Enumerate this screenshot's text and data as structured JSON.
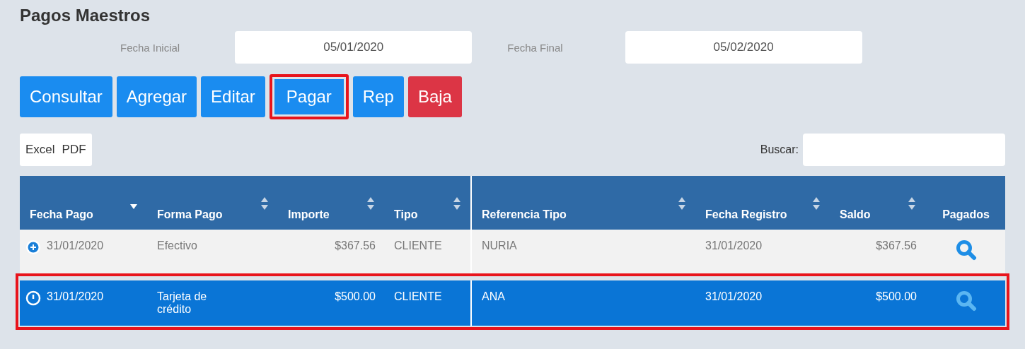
{
  "title": "Pagos Maestros",
  "date_filters": [
    {
      "label": "Fecha Inicial",
      "value": "05/01/2020"
    },
    {
      "label": "Fecha Final",
      "value": "05/02/2020"
    }
  ],
  "buttons": [
    {
      "label": "Consultar",
      "kind": "primary",
      "highlighted": false
    },
    {
      "label": "Agregar",
      "kind": "primary",
      "highlighted": false
    },
    {
      "label": "Editar",
      "kind": "primary",
      "highlighted": false
    },
    {
      "label": "Pagar",
      "kind": "primary",
      "highlighted": true
    },
    {
      "label": "Rep",
      "kind": "primary",
      "highlighted": false
    },
    {
      "label": "Baja",
      "kind": "danger",
      "highlighted": false
    }
  ],
  "export_buttons": [
    "Excel",
    "PDF"
  ],
  "search": {
    "label": "Buscar:"
  },
  "table": {
    "columns": [
      {
        "label": "Fecha Pago",
        "sortable": true,
        "sorted": true
      },
      {
        "label": "Forma Pago",
        "sortable": true,
        "sorted": false
      },
      {
        "label": "Importe",
        "sortable": true,
        "sorted": false
      },
      {
        "label": "Tipo",
        "sortable": true,
        "sorted": false
      },
      {
        "label": "Referencia Tipo",
        "sortable": true,
        "sorted": false
      },
      {
        "label": "Fecha Registro",
        "sortable": true,
        "sorted": false
      },
      {
        "label": "Saldo",
        "sortable": true,
        "sorted": false
      },
      {
        "label": "Pagados",
        "sortable": false
      }
    ],
    "rows": [
      {
        "selected": false,
        "expanded": false,
        "highlighted": false,
        "cells": [
          "31/01/2020",
          "Efectivo",
          "$367.56",
          "CLIENTE",
          "NURIA",
          "31/01/2020",
          "$367.56"
        ]
      },
      {
        "selected": true,
        "expanded": true,
        "highlighted": true,
        "cells": [
          "31/01/2020",
          "Tarjeta de crédito",
          "$500.00",
          "CLIENTE",
          "ANA",
          "31/01/2020",
          "$500.00"
        ]
      }
    ]
  }
}
